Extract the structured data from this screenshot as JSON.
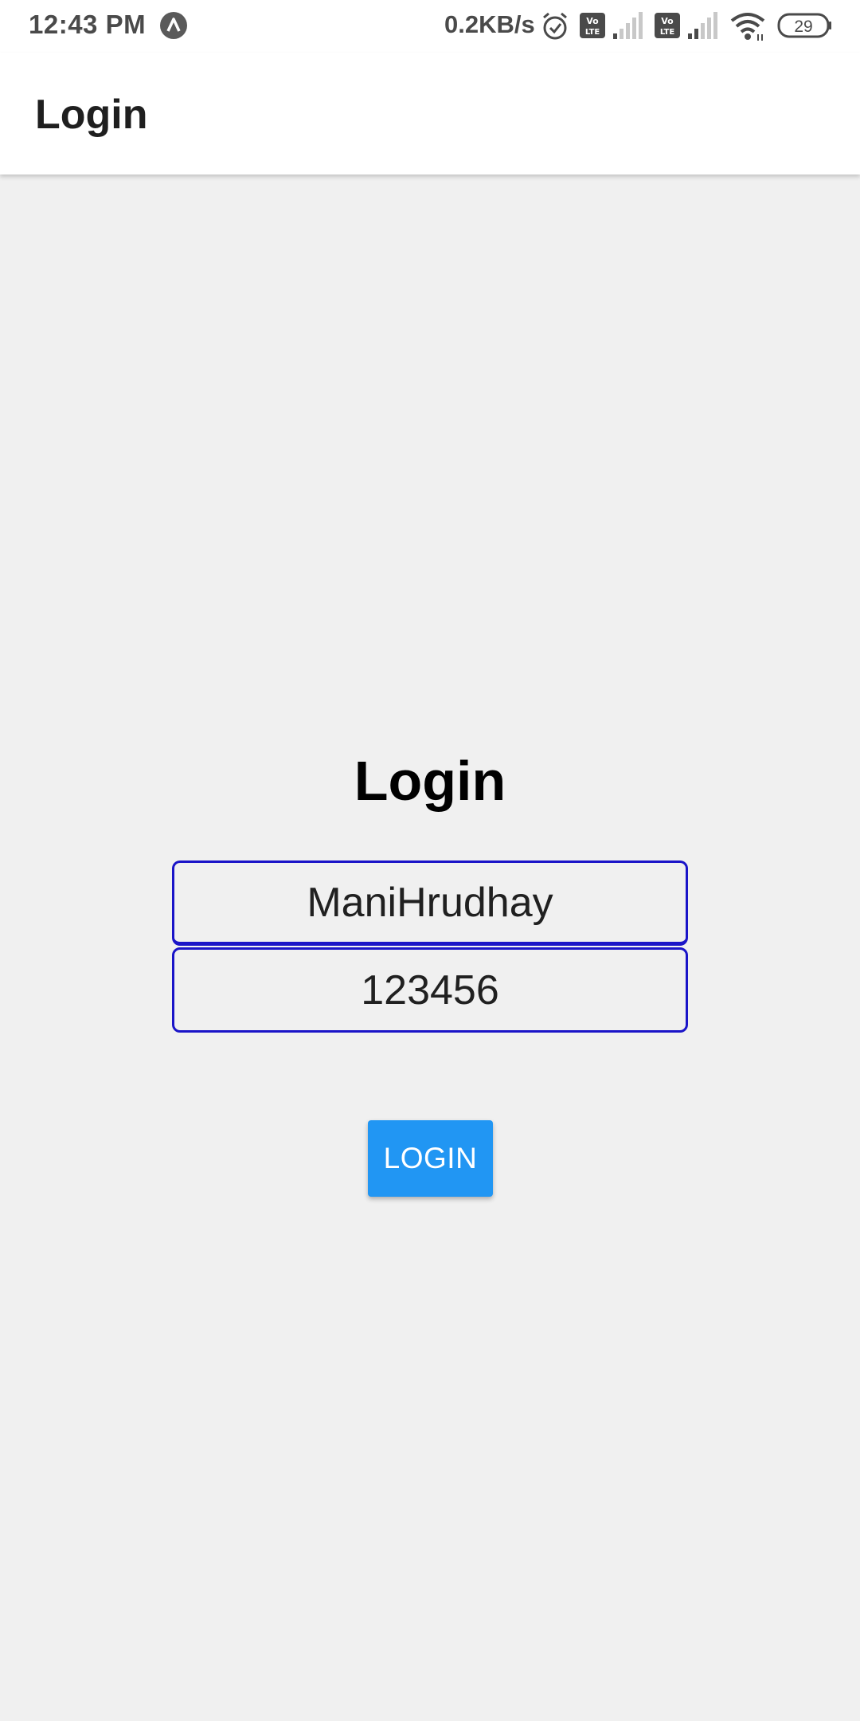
{
  "status_bar": {
    "time": "12:43 PM",
    "net_speed": "0.2KB/s",
    "battery": "29",
    "icons": [
      "notification-icon",
      "alarm-icon",
      "volte-icon",
      "signal-icon",
      "volte-icon",
      "signal-icon",
      "wifi-icon",
      "battery-icon"
    ]
  },
  "app_bar": {
    "title": "Login"
  },
  "form": {
    "heading": "Login",
    "username_value": "ManiHrudhay",
    "password_value": "123456",
    "button_label": "LOGIN"
  },
  "colors": {
    "accent": "#2196f3",
    "field_border": "#1a14c8",
    "background": "#f0f0f0"
  }
}
